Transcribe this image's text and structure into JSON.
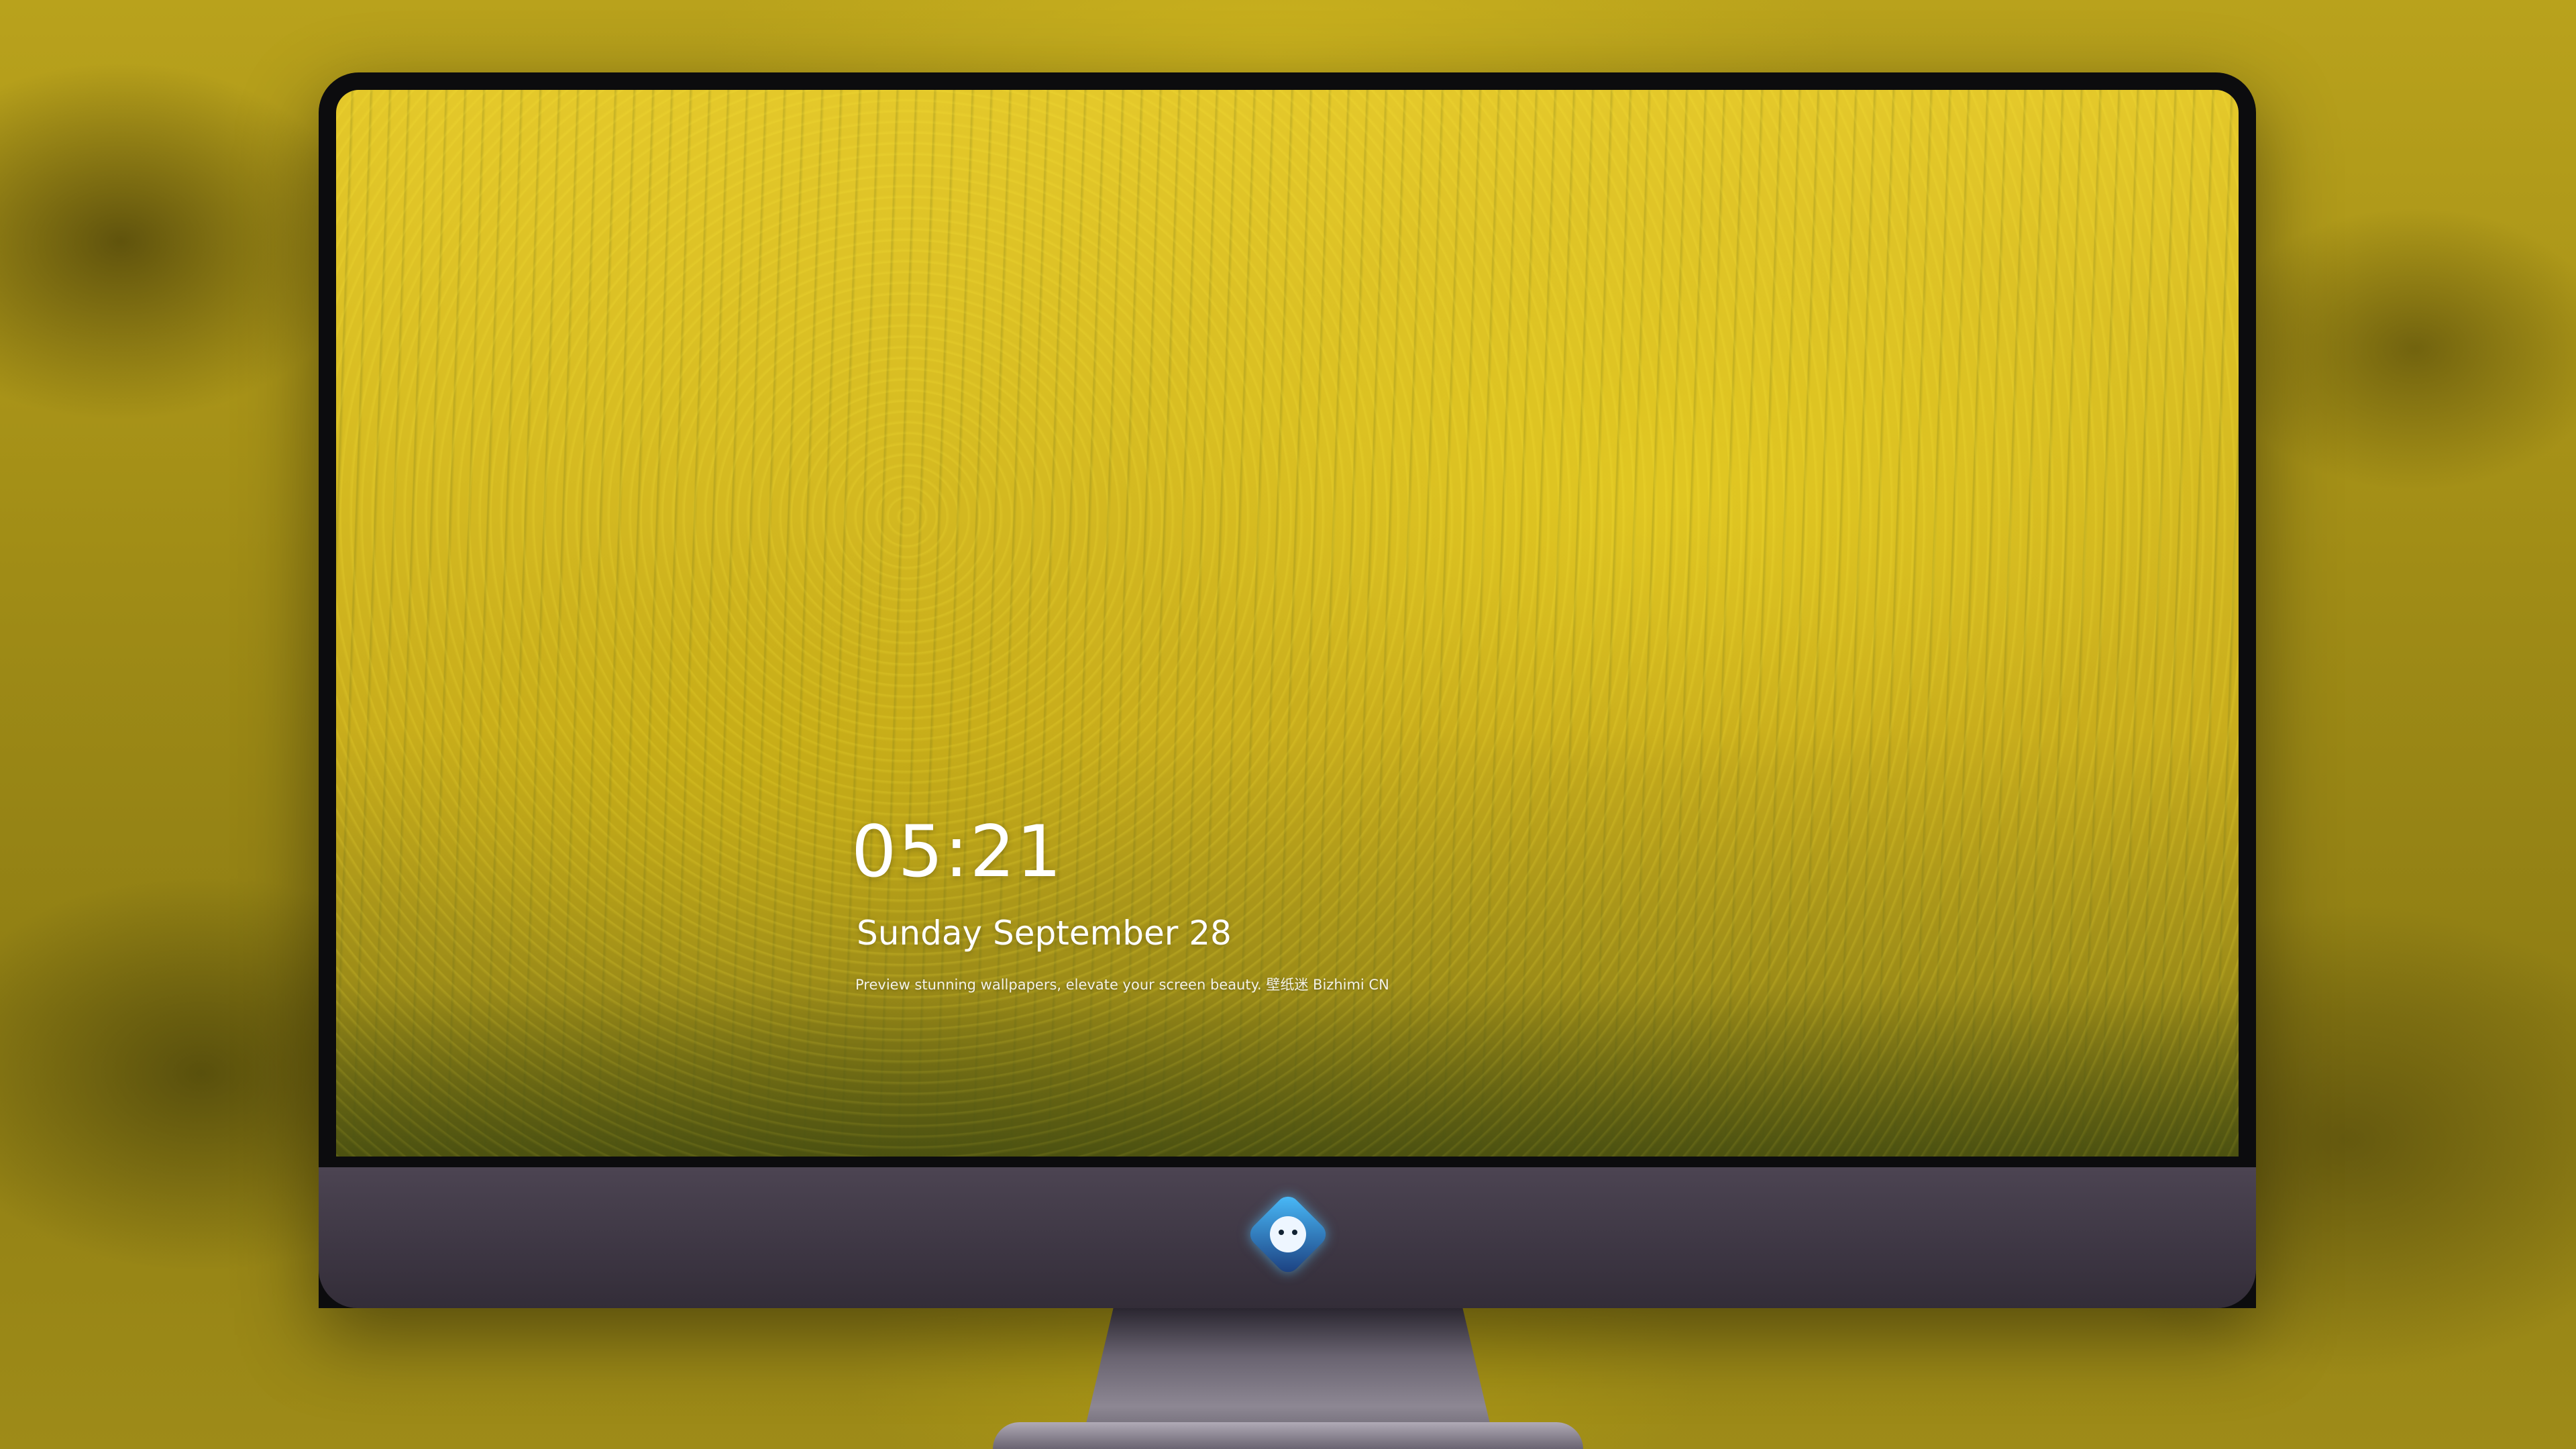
{
  "lock_screen": {
    "time": "05:21",
    "date": "Sunday September 28",
    "tagline": "Preview stunning wallpapers, elevate your screen beauty. 壁纸迷 Bizhimi CN"
  },
  "dock": {
    "items": [
      {
        "name": "messages-icon"
      },
      {
        "name": "weather-icon"
      },
      {
        "name": "clock-icon"
      },
      {
        "name": "preview-icon"
      },
      {
        "name": "clips-icon"
      },
      {
        "name": "notes-icon"
      },
      {
        "name": "photos-icon"
      },
      {
        "name": "music-icon"
      },
      {
        "name": "app-store-icon"
      },
      {
        "name": "camera-icon"
      }
    ]
  },
  "colors": {
    "wallpaper_yellow": "#d8bd22",
    "bezel": "#0c0c0e",
    "chin": "#3d3643",
    "stand": "#8d8793"
  }
}
